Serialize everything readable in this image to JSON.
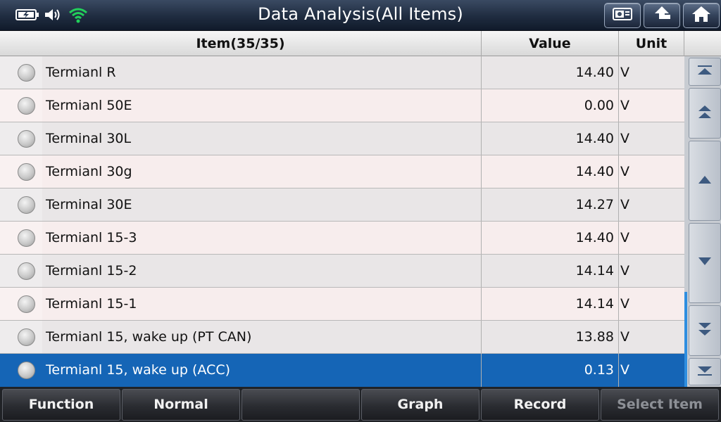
{
  "header": {
    "title": "Data Analysis(All Items)",
    "icons": [
      "battery-icon",
      "speaker-icon",
      "wifi-icon",
      "screenshot-icon",
      "back-icon",
      "home-icon"
    ],
    "accent": "#22d05a"
  },
  "table": {
    "columns": {
      "item": "Item(35/35)",
      "value": "Value",
      "unit": "Unit"
    },
    "rows": [
      {
        "label": "Termianl R",
        "value": "14.40",
        "unit": "V"
      },
      {
        "label": "Termianl 50E",
        "value": "0.00",
        "unit": "V"
      },
      {
        "label": "Terminal 30L",
        "value": "14.40",
        "unit": "V"
      },
      {
        "label": "Termianl 30g",
        "value": "14.40",
        "unit": "V"
      },
      {
        "label": "Terminal 30E",
        "value": "14.27",
        "unit": "V"
      },
      {
        "label": "Termianl 15-3",
        "value": "14.40",
        "unit": "V"
      },
      {
        "label": "Termianl 15-2",
        "value": "14.14",
        "unit": "V"
      },
      {
        "label": "Termianl 15-1",
        "value": "14.14",
        "unit": "V"
      },
      {
        "label": "Termianl 15, wake up (PT CAN)",
        "value": "13.88",
        "unit": "V"
      },
      {
        "label": "Termianl 15, wake up (ACC)",
        "value": "0.13",
        "unit": "V"
      }
    ],
    "selected_row": 9,
    "selected_color": "#1565b6"
  },
  "scroll": {
    "buttons": [
      "scroll-top-icon",
      "page-up-icon",
      "line-up-icon",
      "line-down-icon",
      "page-down-icon",
      "scroll-bottom-icon"
    ]
  },
  "bottom_bar": {
    "function_label": "Function",
    "normal_label": "Normal",
    "empty_label": "",
    "graph_label": "Graph",
    "record_label": "Record",
    "select_item_label": "Select Item"
  }
}
